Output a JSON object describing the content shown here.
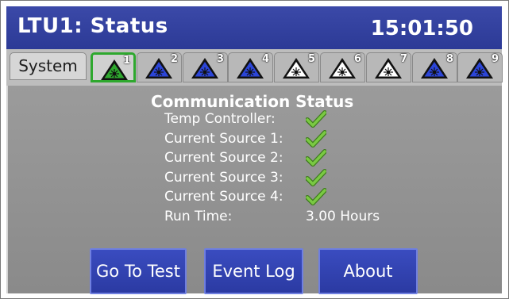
{
  "header": {
    "title": "LTU1: Status",
    "time": "15:01:50"
  },
  "tabs": {
    "system_label": "System",
    "laser_tabs": [
      {
        "number": "1",
        "icon": "laser-warning-icon",
        "color": "#2ea82e",
        "active": true
      },
      {
        "number": "2",
        "icon": "laser-warning-icon",
        "color": "#2b45d8",
        "active": false
      },
      {
        "number": "3",
        "icon": "laser-warning-icon",
        "color": "#2b45d8",
        "active": false
      },
      {
        "number": "4",
        "icon": "laser-warning-icon",
        "color": "#2b45d8",
        "active": false
      },
      {
        "number": "5",
        "icon": "laser-warning-icon",
        "color": "#ffffff",
        "active": false
      },
      {
        "number": "6",
        "icon": "laser-warning-icon",
        "color": "#ffffff",
        "active": false
      },
      {
        "number": "7",
        "icon": "laser-warning-icon",
        "color": "#ffffff",
        "active": false
      },
      {
        "number": "8",
        "icon": "laser-warning-icon",
        "color": "#2b45d8",
        "active": false
      },
      {
        "number": "9",
        "icon": "laser-warning-icon",
        "color": "#2b45d8",
        "active": false
      }
    ]
  },
  "status": {
    "heading": "Communication Status",
    "rows": [
      {
        "label": "Temp Controller:",
        "state": "ok"
      },
      {
        "label": "Current Source 1:",
        "state": "ok"
      },
      {
        "label": "Current Source 2:",
        "state": "ok"
      },
      {
        "label": "Current Source 3:",
        "state": "ok"
      },
      {
        "label": "Current Source 4:",
        "state": "ok"
      }
    ],
    "runtime_label": "Run Time:",
    "runtime_value": "3.00 Hours"
  },
  "buttons": {
    "go_to_test": "Go To Test",
    "event_log": "Event Log",
    "about": "About"
  },
  "colors": {
    "header_bg": "#2c3a96",
    "button_bg": "#3a4cc0",
    "panel_bg": "#949494",
    "active_tab_border": "#2ea82e",
    "check_green": "#7ac943"
  }
}
